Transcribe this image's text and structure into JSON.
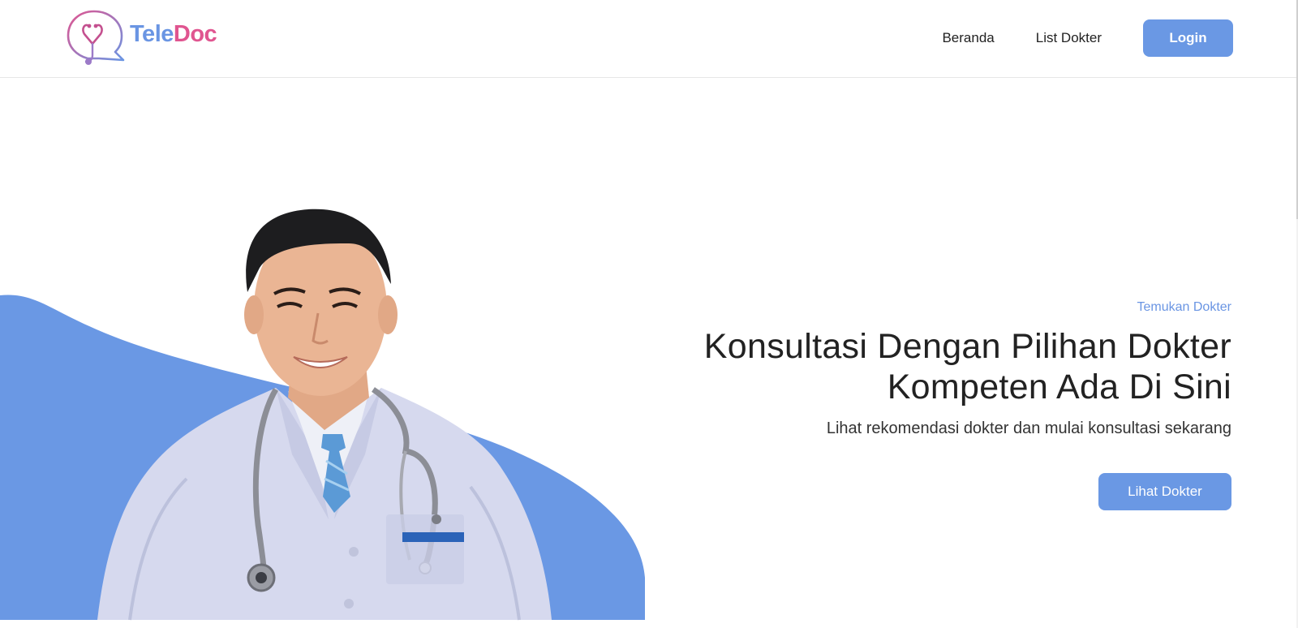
{
  "brand": {
    "part1": "Tele",
    "part2": "Doc",
    "logo_icon": "chat-stethoscope-icon"
  },
  "nav": {
    "links": [
      {
        "label": "Beranda"
      },
      {
        "label": "List Dokter"
      }
    ],
    "login_label": "Login"
  },
  "hero": {
    "eyebrow": "Temukan Dokter",
    "headline_line1": "Konsultasi Dengan Pilihan Dokter",
    "headline_line2": "Kompeten Ada Di Sini",
    "subline": "Lihat rekomendasi dokter dan mulai konsultasi sekarang",
    "cta_label": "Lihat Dokter",
    "image": "doctor-portrait"
  },
  "colors": {
    "accent": "#6a98e4",
    "brand_blue": "#6a95e3",
    "brand_pink": "#e05590"
  }
}
